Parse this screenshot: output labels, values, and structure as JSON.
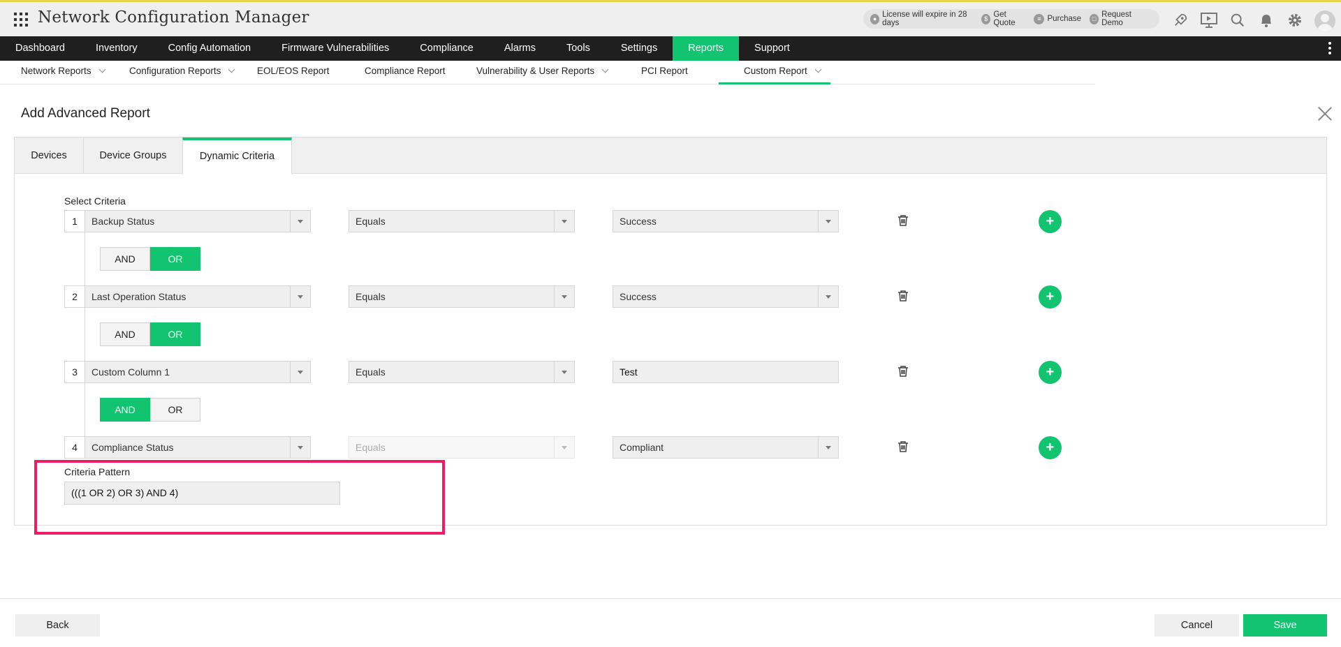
{
  "app": {
    "title": "Network Configuration Manager"
  },
  "license": {
    "expiry": "License will expire in 28 days",
    "get_quote": "Get Quote",
    "purchase": "Purchase",
    "request_demo": "Request Demo"
  },
  "top_icons": [
    "rocket-icon",
    "presentation-icon",
    "search-icon",
    "bell-icon",
    "gear-icon"
  ],
  "main_nav": [
    {
      "label": "Dashboard",
      "active": false
    },
    {
      "label": "Inventory",
      "active": false
    },
    {
      "label": "Config Automation",
      "active": false
    },
    {
      "label": "Firmware Vulnerabilities",
      "active": false
    },
    {
      "label": "Compliance",
      "active": false
    },
    {
      "label": "Alarms",
      "active": false
    },
    {
      "label": "Tools",
      "active": false
    },
    {
      "label": "Settings",
      "active": false
    },
    {
      "label": "Reports",
      "active": true
    },
    {
      "label": "Support",
      "active": false
    }
  ],
  "sub_nav": [
    {
      "label": "Network Reports",
      "dropdown": true
    },
    {
      "label": "Configuration Reports",
      "dropdown": true
    },
    {
      "label": "EOL/EOS Report",
      "dropdown": false
    },
    {
      "label": "Compliance Report",
      "dropdown": false
    },
    {
      "label": "Vulnerability & User Reports",
      "dropdown": true
    },
    {
      "label": "PCI Report",
      "dropdown": false
    },
    {
      "label": "Custom Report",
      "dropdown": true,
      "active": true
    }
  ],
  "page": {
    "title": "Add Advanced Report"
  },
  "tabs": [
    {
      "label": "Devices"
    },
    {
      "label": "Device Groups"
    },
    {
      "label": "Dynamic Criteria",
      "active": true
    }
  ],
  "criteria": {
    "label": "Select Criteria",
    "rows": [
      {
        "num": "1",
        "field": "Backup Status",
        "operator": "Equals",
        "value": "Success",
        "value_type": "dropdown"
      },
      {
        "num": "2",
        "field": "Last Operation Status",
        "operator": "Equals",
        "value": "Success",
        "value_type": "dropdown"
      },
      {
        "num": "3",
        "field": "Custom Column 1",
        "operator": "Equals",
        "value": "Test",
        "value_type": "text"
      },
      {
        "num": "4",
        "field": "Compliance Status",
        "operator": "Equals",
        "value": "Compliant",
        "value_type": "dropdown",
        "operator_disabled": true
      }
    ],
    "connectors": [
      {
        "and": "AND",
        "or": "OR",
        "selected": "OR"
      },
      {
        "and": "AND",
        "or": "OR",
        "selected": "OR"
      },
      {
        "and": "AND",
        "or": "OR",
        "selected": "AND"
      }
    ]
  },
  "pattern": {
    "label": "Criteria Pattern",
    "value": "(((1 OR 2) OR 3) AND 4)"
  },
  "footer": {
    "back": "Back",
    "cancel": "Cancel",
    "save": "Save"
  },
  "colors": {
    "accent": "#12c36f",
    "highlight": "#ee1c60",
    "nav_bg": "#1f1f1f"
  }
}
